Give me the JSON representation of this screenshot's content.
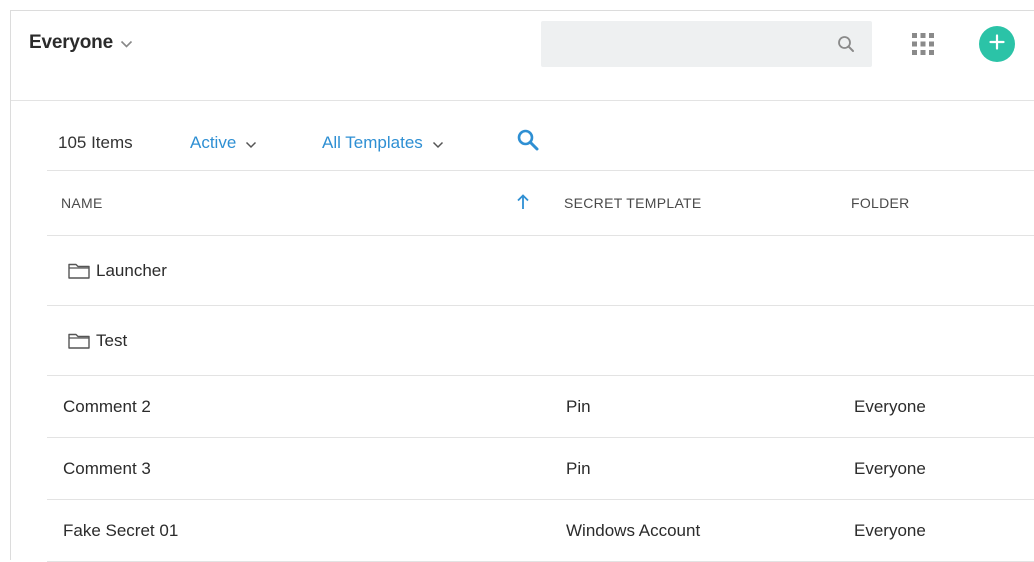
{
  "header": {
    "folder_title": "Everyone",
    "search": {
      "value": "",
      "placeholder": ""
    },
    "icons": {
      "folder_dropdown": "chevron-down-icon",
      "search": "search-icon",
      "apps": "apps-grid-icon",
      "add": "plus-icon"
    },
    "accent_color": "#2bc3a7"
  },
  "toolbar": {
    "item_count": "105 Items",
    "status_filter": "Active",
    "template_filter": "All Templates",
    "link_color": "#2e8fd3"
  },
  "table": {
    "columns": {
      "name": "NAME",
      "secret_template": "SECRET TEMPLATE",
      "folder": "FOLDER"
    },
    "sort": {
      "column": "name",
      "direction": "ascending"
    },
    "folders": [
      {
        "name": "Launcher"
      },
      {
        "name": "Test"
      }
    ],
    "secrets": [
      {
        "name": "Comment 2",
        "template": "Pin",
        "folder": "Everyone"
      },
      {
        "name": "Comment 3",
        "template": "Pin",
        "folder": "Everyone"
      },
      {
        "name": "Fake Secret 01",
        "template": "Windows Account",
        "folder": "Everyone"
      }
    ]
  }
}
